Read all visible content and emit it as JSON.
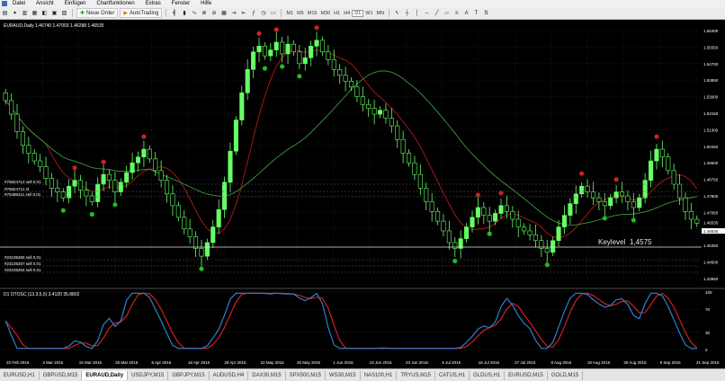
{
  "menu": [
    "Datei",
    "Ansicht",
    "Einfügen",
    "Chartfunktionen",
    "Extras",
    "Fenster",
    "Hilfe"
  ],
  "toolbar": {
    "new_order": "Neue Order",
    "autotrading": "AutoTrading",
    "timeframes": [
      "M1",
      "M5",
      "M15",
      "M30",
      "H1",
      "H4",
      "D1",
      "W1",
      "MN"
    ]
  },
  "chart": {
    "header": "EURAUD,Daily  1.46740 1.47003 1.46288 1.46535",
    "keylevel_label": "Keylevel",
    "keylevel_value": "1,4575",
    "price_labels": [
      "1.56400",
      "1.55550",
      "1.54700",
      "1.53850",
      "1.53000",
      "1.52150",
      "1.51300",
      "1.50450",
      "1.49600",
      "1.48750",
      "1.47900",
      "1.47050",
      "1.46535",
      "1.46200",
      "1.45350",
      "1.44500",
      "1.43650"
    ],
    "current_price": "1.46535",
    "order_labels": [
      "#76824712 sell 0.01",
      "#76824712 sl",
      "#70486411 sell 0.01",
      "#23105306 sell 0.01",
      "#23105307 sell 0.01",
      "#23105304 sell 0.01"
    ],
    "dates": [
      "22 Feb 2016",
      "3 Mar 2016",
      "15 Mar 2016",
      "25 Mar 2016",
      "6 Apr 2016",
      "18 Apr 2016",
      "28 Apr 2016",
      "10 May 2016",
      "20 May 2016",
      "1 Jun 2016",
      "13 Jun 2016",
      "23 Jun 2016",
      "5 Jul 2016",
      "15 Jul 2016",
      "27 Jul 2016",
      "8 Aug 2016",
      "18 Aug 2016",
      "30 Aug 2016",
      "9 Sep 2016",
      "21 Sep 2016"
    ],
    "oscillator_header": "D1 OTOSC (13.3,5,5) 3.4120 35.8802",
    "osc_levels": [
      "100",
      "70",
      "30",
      "0"
    ]
  },
  "tabs": [
    {
      "label": "EURUSD,H1",
      "active": false
    },
    {
      "label": "GBPUSD,M15",
      "active": false
    },
    {
      "label": "EURAUD,Daily",
      "active": true
    },
    {
      "label": "USDJPY,M15",
      "active": false
    },
    {
      "label": "GBPJPY,M15",
      "active": false
    },
    {
      "label": "AUDUSD,H4",
      "active": false
    },
    {
      "label": "DAX30,M15",
      "active": false
    },
    {
      "label": "SPX500,M15",
      "active": false
    },
    {
      "label": "WS30,M15",
      "active": false
    },
    {
      "label": "NAS100,H1",
      "active": false
    },
    {
      "label": "TRYUS,M15",
      "active": false
    },
    {
      "label": "CATUS,H1",
      "active": false
    },
    {
      "label": "GLDUS,H1",
      "active": false
    },
    {
      "label": "EURUSD,M15",
      "active": false
    },
    {
      "label": "GOLD,M15",
      "active": false
    }
  ],
  "colors": {
    "bg": "#000000",
    "bull_candle": "#66ff66",
    "bear_candle": "#000000",
    "ma_red": "#b01a1a",
    "ma_green": "#3a9a3a",
    "osc_blue": "#2f7fd0",
    "osc_red": "#d02020",
    "grid": "#2a2a2a",
    "keylevel_line": "#e8e8e8"
  },
  "chart_data": {
    "type": "candlestick",
    "price_range": [
      1.4365,
      1.564
    ],
    "keylevel": 1.4575,
    "closes": [
      1.528,
      1.521,
      1.512,
      1.505,
      1.501,
      1.497,
      1.494,
      1.488,
      1.483,
      1.481,
      1.478,
      1.484,
      1.487,
      1.482,
      1.479,
      1.476,
      1.485,
      1.49,
      1.487,
      1.481,
      1.486,
      1.491,
      1.496,
      1.499,
      1.503,
      1.498,
      1.492,
      1.487,
      1.48,
      1.474,
      1.468,
      1.462,
      1.458,
      1.452,
      1.448,
      1.455,
      1.463,
      1.472,
      1.486,
      1.502,
      1.518,
      1.532,
      1.544,
      1.553,
      1.556,
      1.551,
      1.554,
      1.558,
      1.552,
      1.557,
      1.553,
      1.547,
      1.55,
      1.556,
      1.559,
      1.553,
      1.549,
      1.544,
      1.541,
      1.538,
      1.535,
      1.53,
      1.526,
      1.524,
      1.521,
      1.523,
      1.519,
      1.515,
      1.508,
      1.501,
      1.496,
      1.49,
      1.483,
      1.476,
      1.471,
      1.466,
      1.461,
      1.455,
      1.452,
      1.457,
      1.463,
      1.468,
      1.473,
      1.469,
      1.466,
      1.47,
      1.474,
      1.471,
      1.467,
      1.463,
      1.461,
      1.459,
      1.456,
      1.452,
      1.45,
      1.456,
      1.463,
      1.469,
      1.475,
      1.48,
      1.484,
      1.481,
      1.478,
      1.476,
      1.474,
      1.478,
      1.481,
      1.479,
      1.476,
      1.473,
      1.478,
      1.487,
      1.497,
      1.503,
      1.499,
      1.492,
      1.485,
      1.478,
      1.471,
      1.467,
      1.465
    ]
  }
}
